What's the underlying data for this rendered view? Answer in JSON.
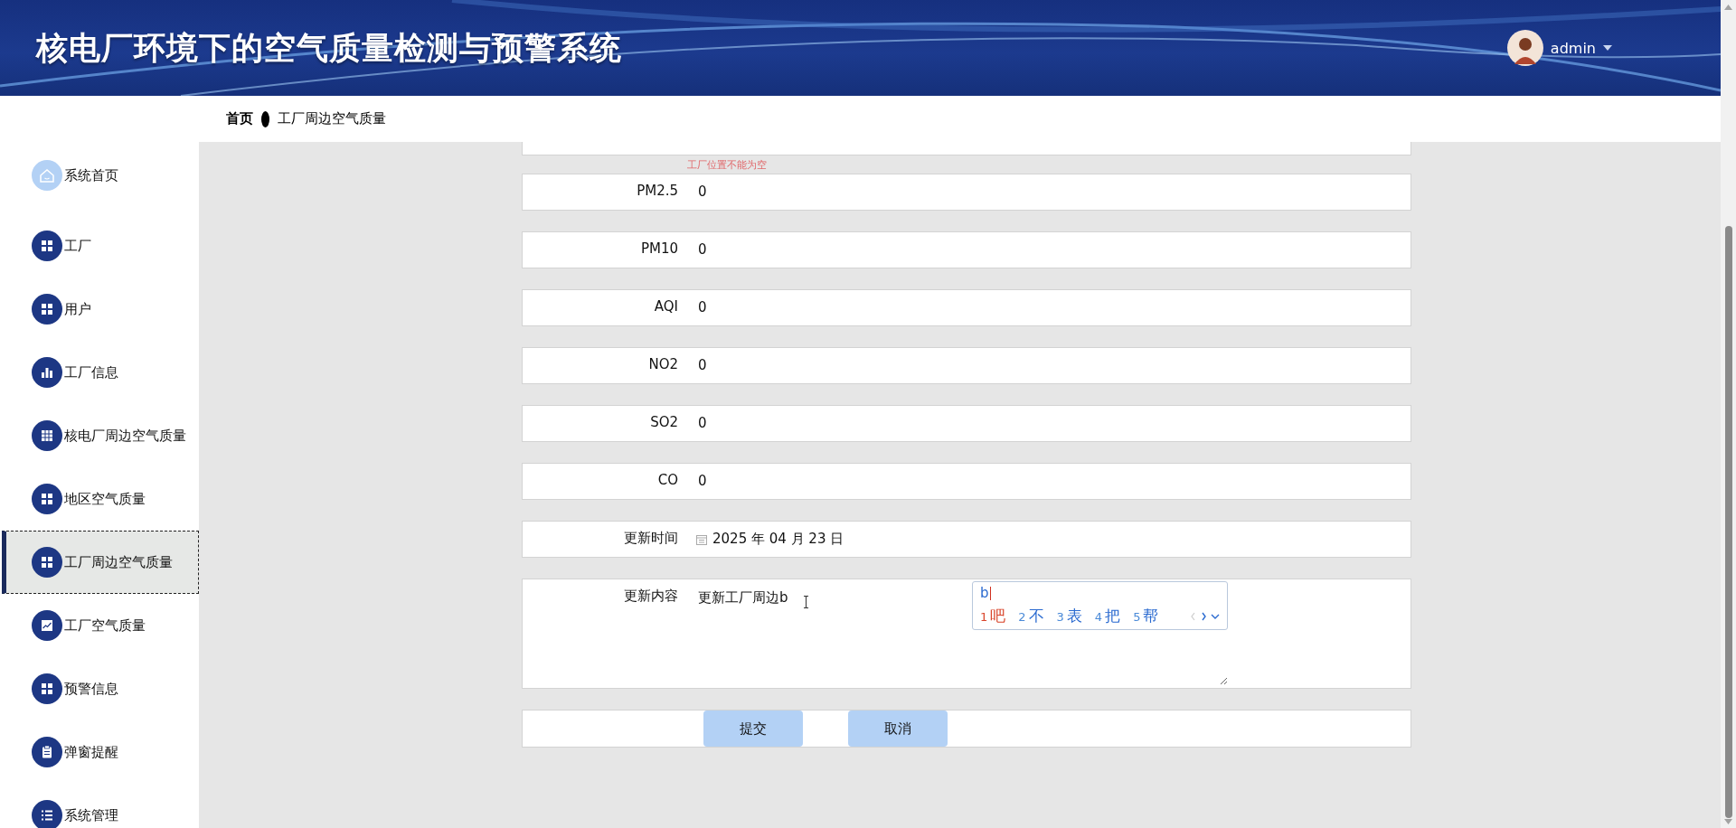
{
  "header": {
    "title": "核电厂环境下的空气质量检测与预警系统",
    "user": "admin"
  },
  "breadcrumb": [
    {
      "label": "首页"
    },
    {
      "label": "工厂周边空气质量"
    }
  ],
  "sidebar": {
    "items": [
      {
        "label": "系统首页",
        "selected": false
      },
      {
        "label": "工厂",
        "selected": false
      },
      {
        "label": "用户",
        "selected": false
      },
      {
        "label": "工厂信息",
        "selected": false
      },
      {
        "label": "核电厂周边空气质量",
        "selected": false
      },
      {
        "label": "地区空气质量",
        "selected": false
      },
      {
        "label": "工厂周边空气质量",
        "selected": true
      },
      {
        "label": "工厂空气质量",
        "selected": false
      },
      {
        "label": "预警信息",
        "selected": false
      },
      {
        "label": "弹窗提醒",
        "selected": false
      },
      {
        "label": "系统管理",
        "selected": false
      }
    ]
  },
  "form": {
    "error": "工厂位置不能为空",
    "fields": [
      {
        "kind": "text",
        "label": "PM2.5",
        "value": "0"
      },
      {
        "kind": "text",
        "label": "PM10",
        "value": "0"
      },
      {
        "kind": "text",
        "label": "AQI",
        "value": "0"
      },
      {
        "kind": "text",
        "label": "NO2",
        "value": "0"
      },
      {
        "kind": "text",
        "label": "SO2",
        "value": "0"
      },
      {
        "kind": "text",
        "label": "CO",
        "value": "0"
      },
      {
        "kind": "date",
        "label": "更新时间",
        "value": "2025 年 04 月 23 日"
      },
      {
        "kind": "textarea",
        "label": "更新内容",
        "value": "更新工厂周边b"
      }
    ],
    "buttons": [
      {
        "label": "提交"
      },
      {
        "label": "取消"
      }
    ]
  },
  "ime": {
    "composition": "b",
    "candidates": [
      {
        "number": "1",
        "text": "吧",
        "selected": true
      },
      {
        "number": "2",
        "text": "不",
        "selected": false
      },
      {
        "number": "3",
        "text": "表",
        "selected": false
      },
      {
        "number": "4",
        "text": "把",
        "selected": false
      },
      {
        "number": "5",
        "text": "帮",
        "selected": false
      }
    ]
  }
}
